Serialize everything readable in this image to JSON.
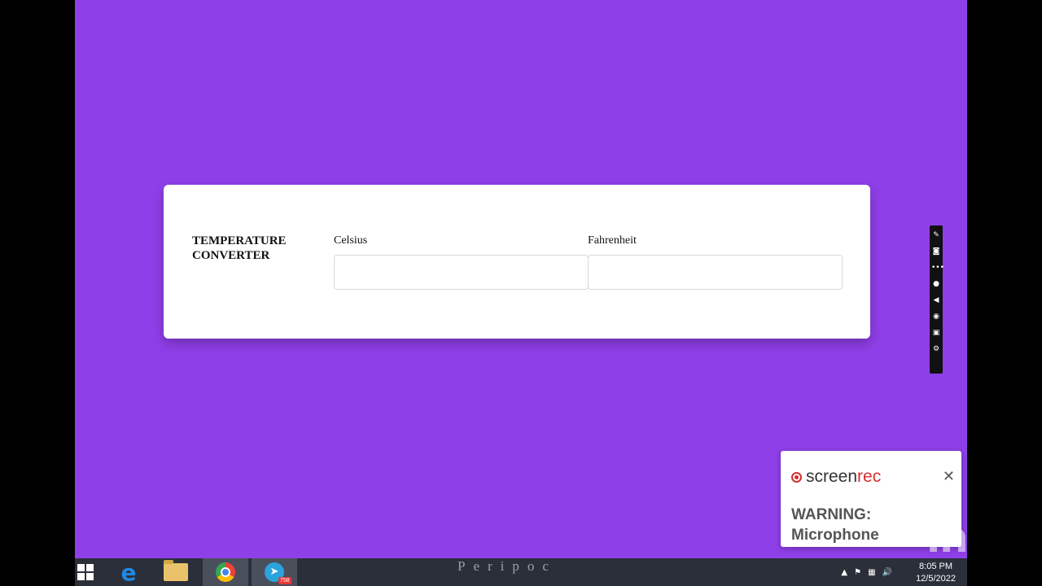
{
  "converter": {
    "title": "TEMPERATURE CONVERTER",
    "celsius_label": "Celsius",
    "celsius_value": "",
    "fahrenheit_label": "Fahrenheit",
    "fahrenheit_value": ""
  },
  "screenrec_popup": {
    "brand_part1": "screen",
    "brand_part2": "rec",
    "close_glyph": "✕",
    "warning": "WARNING: Microphone"
  },
  "watermark": "inShOt",
  "taskbar": {
    "center_text": "Peripoc",
    "telegram_badge": "758",
    "time": "8:05 PM",
    "date": "12/5/2022"
  },
  "icons": {
    "recorder_toolbar": [
      "pen-icon",
      "camera-icon",
      "more-icon",
      "microphone-icon",
      "speaker-icon",
      "webcam-icon",
      "window-icon",
      "settings-icon"
    ]
  },
  "colors": {
    "background": "#8f3fe8",
    "card": "#ffffff",
    "taskbar": "#2b2f3a",
    "brand_accent": "#d32f2f"
  }
}
